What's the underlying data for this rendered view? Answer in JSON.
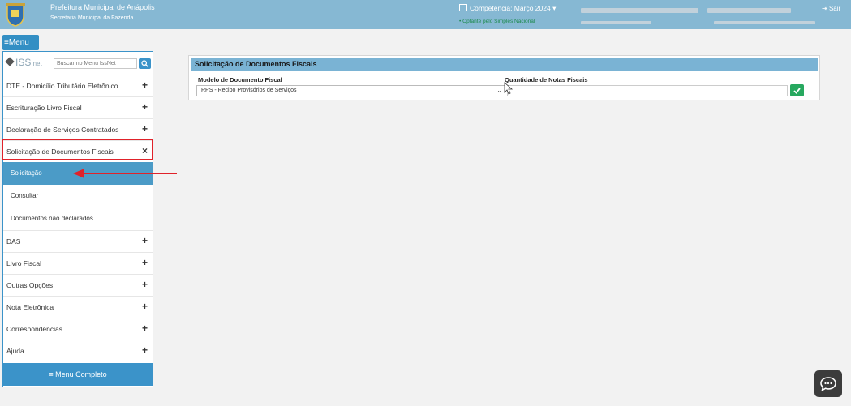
{
  "header": {
    "org_name": "Prefeitura Municipal de Anápolis",
    "org_sub": "Secretaria Municipal da Fazenda",
    "competencia": "Competência: Março 2024",
    "competencia_caret": "▾",
    "simples": "• Optante pelo Simples Nacional",
    "logout": "Sair",
    "logout_icon": "⇥"
  },
  "menu_toggle": {
    "label": "Menu",
    "icon": "≡"
  },
  "sidebar": {
    "logo_text": "ISS",
    "logo_suffix": ".net",
    "search_placeholder": "Buscar no Menu IssNet",
    "items": [
      {
        "label": "DTE - Domicílio Tributário Eletrônico",
        "toggle": "+"
      },
      {
        "label": "Escrituração Livro Fiscal",
        "toggle": "+"
      },
      {
        "label": "Declaração de Serviços Contratados",
        "toggle": "+"
      },
      {
        "label": "Solicitação de Documentos Fiscais",
        "toggle": "×"
      },
      {
        "label": "DAS",
        "toggle": "+"
      },
      {
        "label": "Livro Fiscal",
        "toggle": "+"
      },
      {
        "label": "Outras Opções",
        "toggle": "+"
      },
      {
        "label": "Nota Eletrônica",
        "toggle": "+"
      },
      {
        "label": "Correspondências",
        "toggle": "+"
      },
      {
        "label": "Ajuda",
        "toggle": "+"
      }
    ],
    "subitems": [
      {
        "label": "Solicitação",
        "active": true
      },
      {
        "label": "Consultar",
        "active": false
      },
      {
        "label": "Documentos não declarados",
        "active": false
      }
    ],
    "full_menu": "Menu Completo",
    "full_menu_icon": "≡"
  },
  "panel": {
    "title": "Solicitação de Documentos Fiscais",
    "model_label": "Modelo de Documento Fiscal",
    "model_value": "RPS - Recibo Provisórios de Serviços",
    "qty_label": "Quantidade de Notas Fiscais",
    "qty_value": ""
  },
  "colors": {
    "topbar": "#86b8d3",
    "accent": "#3b93c9",
    "active_sub": "#4b9bc7",
    "highlight": "#e0222a",
    "ok": "#27a85f"
  }
}
